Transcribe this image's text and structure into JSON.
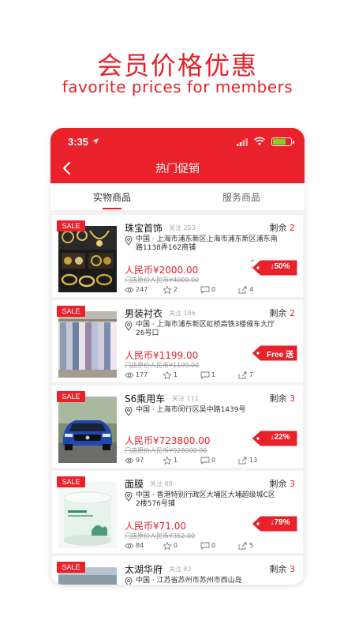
{
  "promo": {
    "title": "会员价格优惠",
    "subtitle": "favorite prices for members"
  },
  "status_bar": {
    "time": "3:35"
  },
  "nav": {
    "title": "热门促销"
  },
  "tabs": [
    {
      "label": "实物商品",
      "selected": true
    },
    {
      "label": "服务商品",
      "selected": false
    }
  ],
  "colors": {
    "accent": "#e8212b",
    "battery": "#7ed321"
  },
  "items": [
    {
      "badge": "SALE",
      "name": "珠宝首饰",
      "follow": "关注 253",
      "remain_label": "剩余",
      "remain_num": "2",
      "address": "中国 · 上海市浦东新区上海市浦东新区浦东南路1138弄162商铺",
      "price": "人民币¥2000.00",
      "original": "门店原价人民币¥4000.00",
      "tag": "↓50%",
      "views": "247",
      "stars": "2",
      "comments": "0",
      "shares": "4"
    },
    {
      "badge": "SALE",
      "name": "男装衬衣",
      "follow": "关注 186",
      "remain_label": "剩余",
      "remain_num": "2",
      "address": "中国 · 上海市浦东新区虹桥高铁3楼候车大厅26号口",
      "price": "人民币¥1199.00",
      "original": "门店原价人民币¥1199.00",
      "tag": "Free 送",
      "views": "177",
      "stars": "1",
      "comments": "1",
      "shares": "7"
    },
    {
      "badge": "SALE",
      "name": "S6乘用车",
      "follow": "关注 111",
      "remain_label": "剩余",
      "remain_num": "3",
      "address": "中国 · 上海市闵行区吴中路1439号",
      "price": "人民币¥723800.00",
      "original": "门店原价人民币¥928000.00",
      "tag": "↓22%",
      "views": "97",
      "stars": "1",
      "comments": "0",
      "shares": "13"
    },
    {
      "badge": "SALE",
      "name": "面膜",
      "follow": "关注 89",
      "remain_label": "剩余",
      "remain_num": "3",
      "address": "中国 · 香港特别行政区大埔区大埔超级城C区2楼576号铺",
      "price": "人民币¥71.00",
      "original": "门店原价人民币¥352.00",
      "tag": "↓79%",
      "views": "84",
      "stars": "0",
      "comments": "0",
      "shares": "5"
    },
    {
      "badge": "SALE",
      "name": "太湖华府",
      "follow": "关注 82",
      "remain_label": "剩余",
      "remain_num": "3",
      "address": "中国 · 江苏省苏州市苏州市西山岛",
      "price": "",
      "original": "",
      "tag": "",
      "views": "",
      "stars": "",
      "comments": "",
      "shares": ""
    }
  ]
}
